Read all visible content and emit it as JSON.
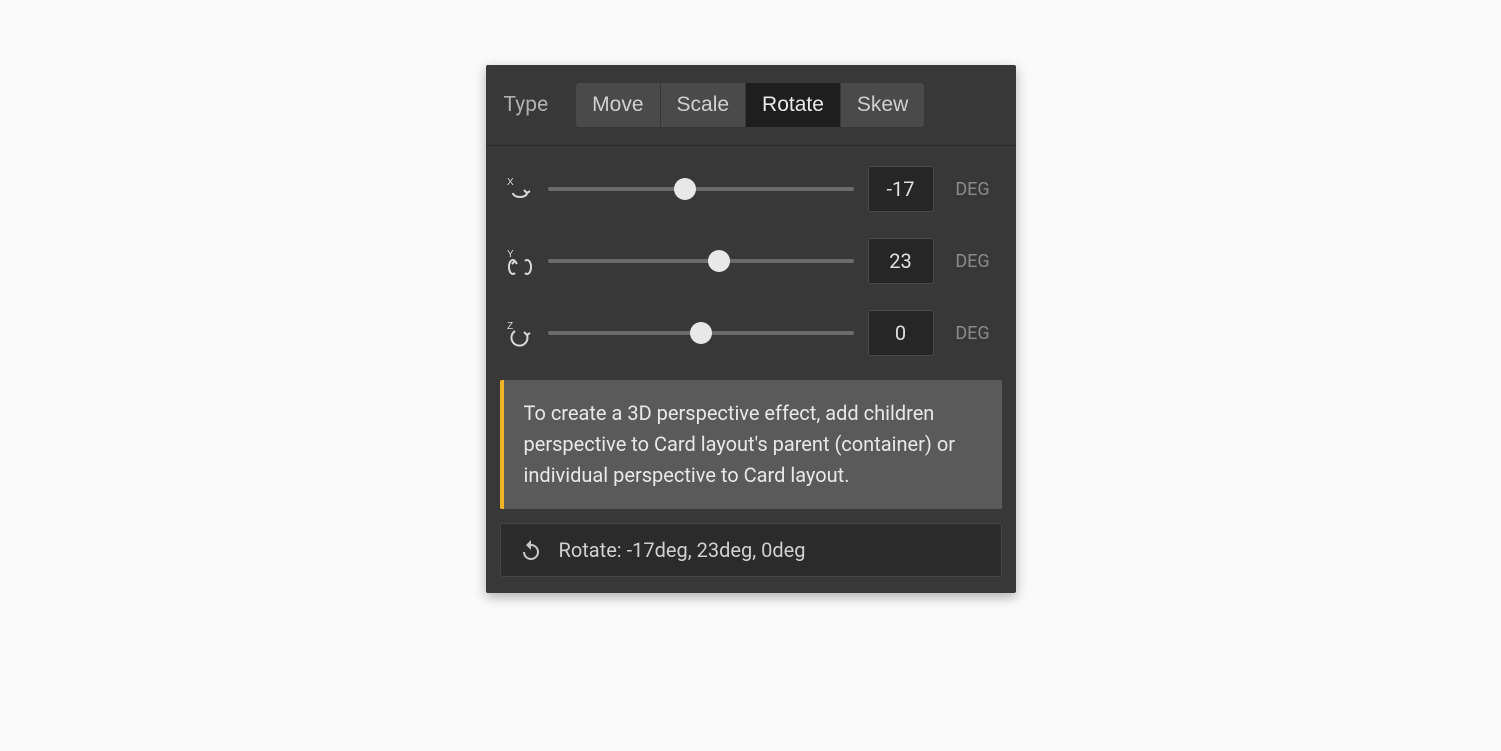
{
  "type_label": "Type",
  "tabs": {
    "move": "Move",
    "scale": "Scale",
    "rotate": "Rotate",
    "skew": "Skew",
    "active": "rotate"
  },
  "axes": {
    "x": {
      "value": "-17",
      "unit": "DEG",
      "thumb_pct": 45
    },
    "y": {
      "value": "23",
      "unit": "DEG",
      "thumb_pct": 56
    },
    "z": {
      "value": "0",
      "unit": "DEG",
      "thumb_pct": 50
    }
  },
  "hint": "To create a 3D perspective effect, add children perspective to Card layout's parent (container) or individual perspective to Card layout.",
  "summary": "Rotate: -17deg, 23deg, 0deg"
}
